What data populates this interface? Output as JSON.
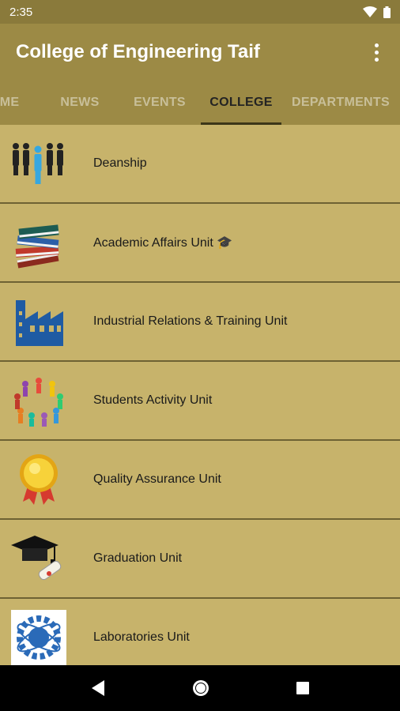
{
  "status_bar": {
    "time": "2:35"
  },
  "app_bar": {
    "title": "College of Engineering Taif"
  },
  "tabs": [
    {
      "label": "ME"
    },
    {
      "label": "NEWS"
    },
    {
      "label": "EVENTS"
    },
    {
      "label": "COLLEGE"
    },
    {
      "label": "DEPARTMENTS"
    }
  ],
  "active_tab": "COLLEGE",
  "list": {
    "items": [
      {
        "label": "Deanship",
        "icon": "people-group-icon"
      },
      {
        "label": "Academic Affairs Unit 🎓",
        "icon": "books-stack-icon"
      },
      {
        "label": "Industrial Relations & Training Unit",
        "icon": "factory-icon"
      },
      {
        "label": "Students Activity Unit",
        "icon": "people-circle-icon"
      },
      {
        "label": "Quality Assurance Unit",
        "icon": "award-medal-icon"
      },
      {
        "label": "Graduation Unit",
        "icon": "graduation-cap-icon"
      },
      {
        "label": "Laboratories Unit",
        "icon": "lab-gear-atom-icon"
      }
    ]
  },
  "colors": {
    "status_bar": "#8a7a3b",
    "app_bar": "#9c8a45",
    "list_background": "#c7b36b",
    "divider": "#6e6233"
  }
}
